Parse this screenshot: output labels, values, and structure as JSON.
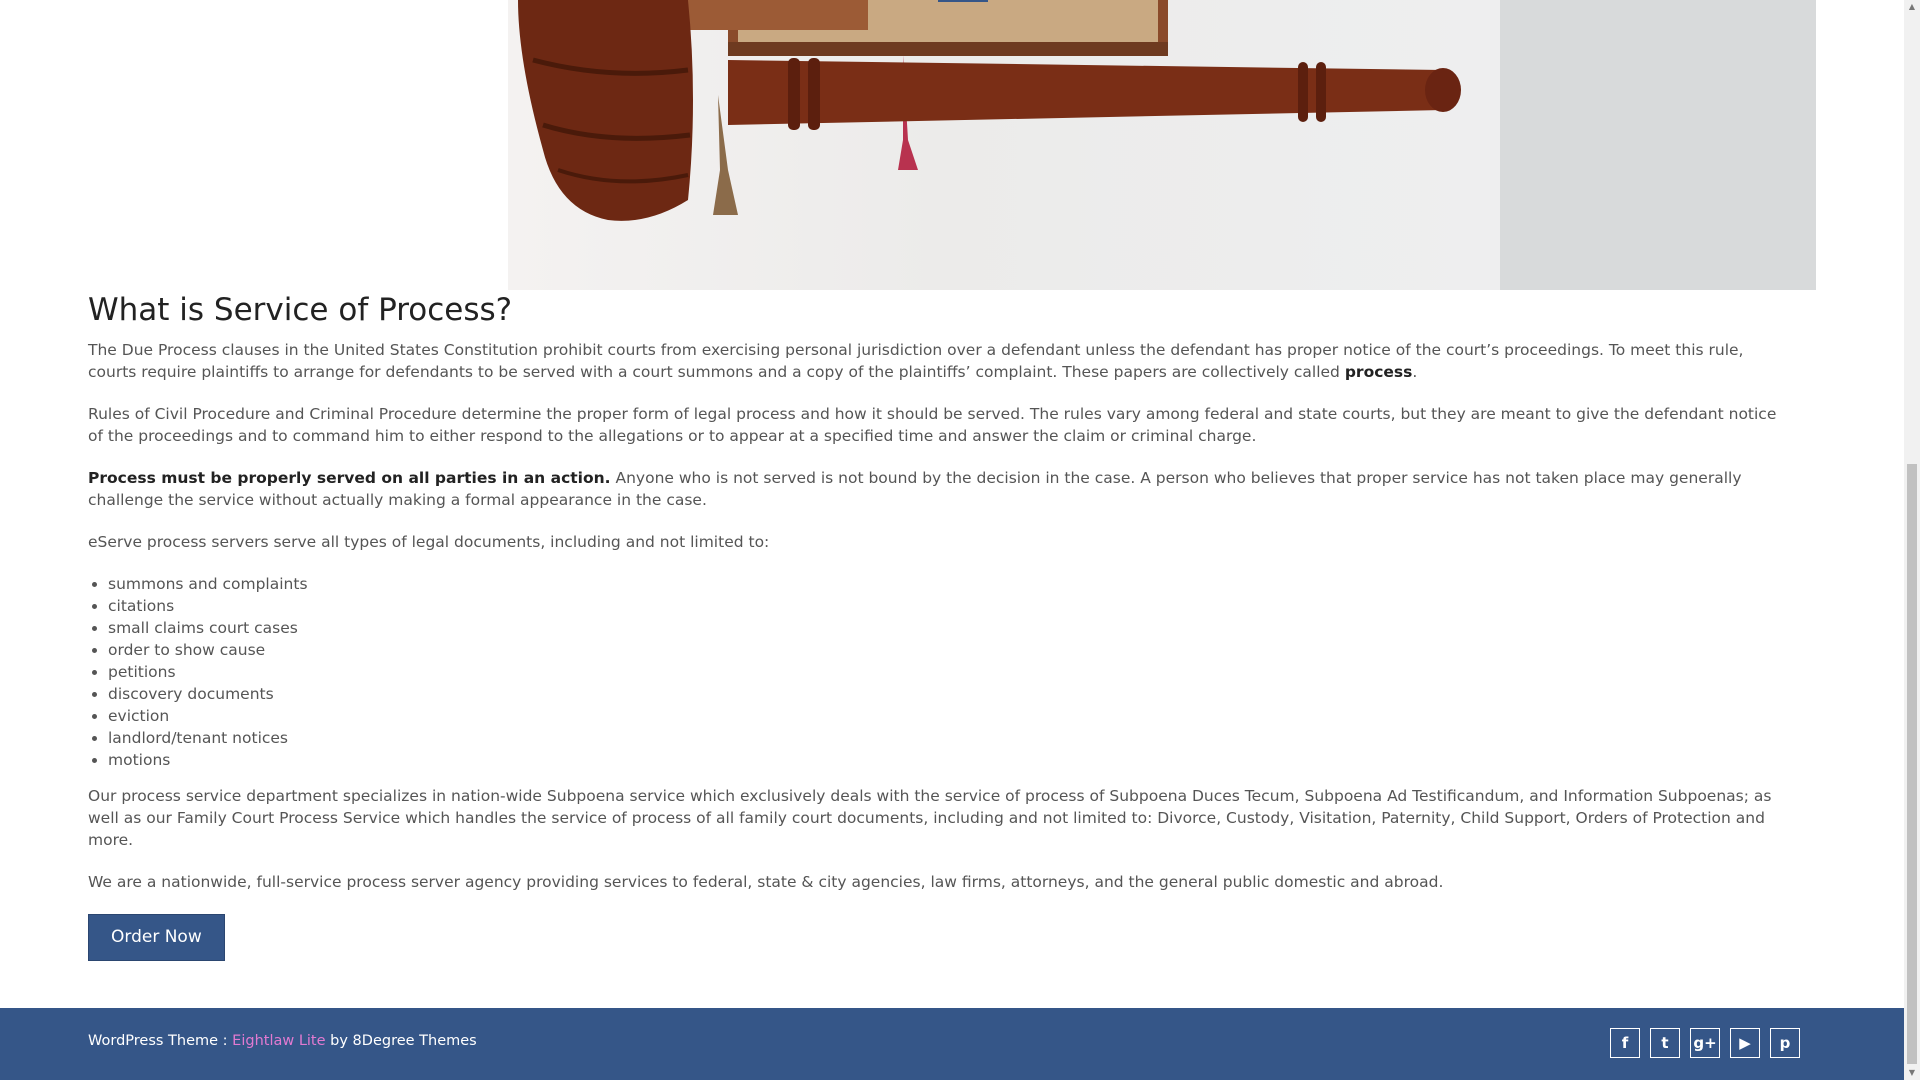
{
  "article": {
    "heading": "What is Service of Process?",
    "p1_text": "The Due Process clauses in the United States Constitution prohibit courts from exercising personal jurisdiction over a defendant unless the defendant has proper notice of the court’s proceedings. To meet this rule, courts require plaintiffs to arrange for defendants to be served with a court summons and a copy of the plaintiffs’ complaint. These papers are collectively called ",
    "p1_bold": "process",
    "p1_end": ".",
    "p2": "Rules of Civil Procedure and Criminal Procedure determine the proper form of legal process and how it should be served. The rules vary among federal and state courts, but they are meant to give the defendant notice of the proceedings and to command him to either respond to the allegations or to appear at a specified time and answer the claim or criminal charge.",
    "p3_bold": "Process must be properly served on all parties in an action.",
    "p3_text": " Anyone who is not served is not bound by the decision in the case. A person who believes that proper service has not taken place may generally challenge the service without actually making a formal appearance in the case.",
    "p4": "eServe process servers serve all types of legal documents, including and not limited to:",
    "documents": [
      "summons and complaints",
      "citations",
      "small claims court cases",
      "order to show cause",
      "petitions",
      "discovery documents",
      "eviction",
      "landlord/tenant notices",
      "motions"
    ],
    "p5": "Our process service department specializes in nation-wide Subpoena service which exclusively deals with the service of process of Subpoena Duces Tecum, Subpoena Ad Testificandum, and Information Subpoenas; as well as our Family Court Process Service which handles the service of process of all family court documents, including and not limited to: Divorce, Custody, Visitation, Paternity, Child Support, Orders of Protection and more.",
    "p6": "We are a nationwide, full-service process server agency providing services to federal, state & city agencies, law firms, attorneys, and the general public domestic and abroad.",
    "order_button": "Order Now"
  },
  "footer": {
    "prefix": "WordPress Theme : ",
    "theme_link": "Eightlaw Lite",
    "suffix": " by 8Degree Themes",
    "social": [
      {
        "name": "facebook-icon",
        "glyph": "f"
      },
      {
        "name": "twitter-icon",
        "glyph": "t"
      },
      {
        "name": "google-plus-icon",
        "glyph": "g+"
      },
      {
        "name": "youtube-icon",
        "glyph": "▶"
      },
      {
        "name": "pinterest-icon",
        "glyph": "p"
      }
    ]
  },
  "colors": {
    "primary": "#355688",
    "link": "#e27ad1",
    "text": "#555555",
    "heading": "#222222"
  }
}
